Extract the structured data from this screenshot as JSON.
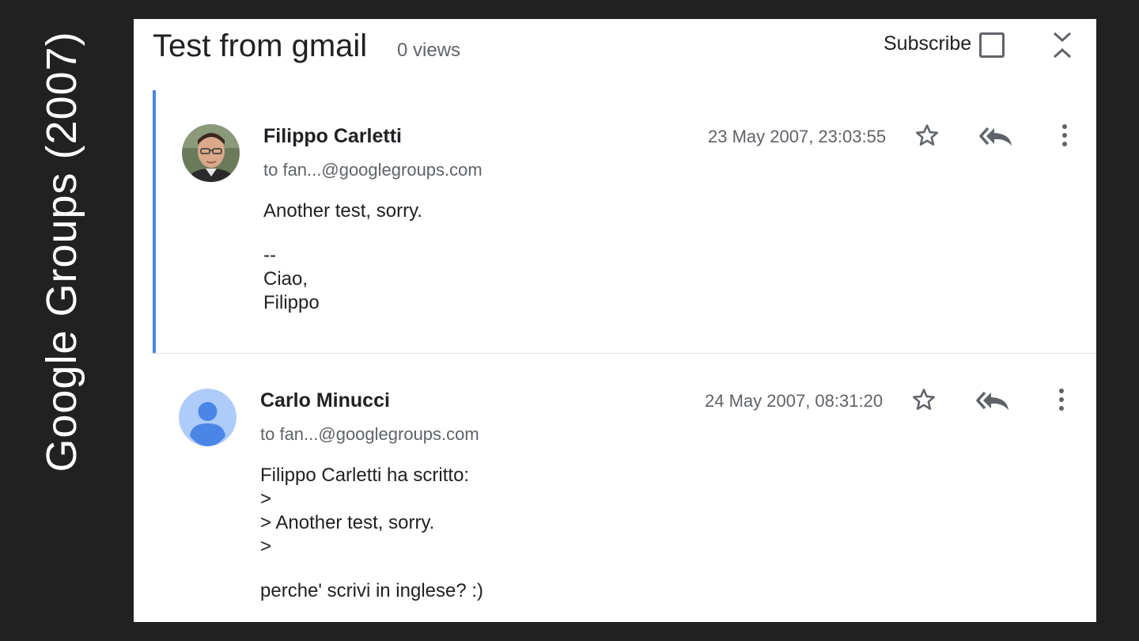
{
  "side_caption": "Google Groups (2007)",
  "thread": {
    "title": "Test from gmail",
    "views": "0 views",
    "subscribe_label": "Subscribe"
  },
  "messages": [
    {
      "sender": "Filippo Carletti",
      "recipient": "to fan...@googlegroups.com",
      "date": "23 May 2007, 23:03:55",
      "avatar": "profile-photo",
      "body_paragraphs": [
        [
          "Another test, sorry."
        ],
        [
          "--",
          "Ciao,",
          "Filippo"
        ]
      ]
    },
    {
      "sender": "Carlo Minucci",
      "recipient": "to fan...@googlegroups.com",
      "date": "24 May 2007, 08:31:20",
      "avatar": "default-person-icon",
      "body_paragraphs": [
        [
          "Filippo Carletti ha scritto:",
          ">",
          "> Another test, sorry.",
          ">"
        ],
        [
          "perche' scrivi in inglese? :)"
        ]
      ]
    }
  ],
  "colors": {
    "background": "#212121",
    "panel": "#ffffff",
    "accent_border": "#4a86e8",
    "default_avatar": "#aecbfa",
    "default_avatar_figure": "#4a86e8"
  },
  "icons": [
    "star-icon",
    "reply-all-icon",
    "more-vert-icon",
    "collapse-all-icon"
  ]
}
